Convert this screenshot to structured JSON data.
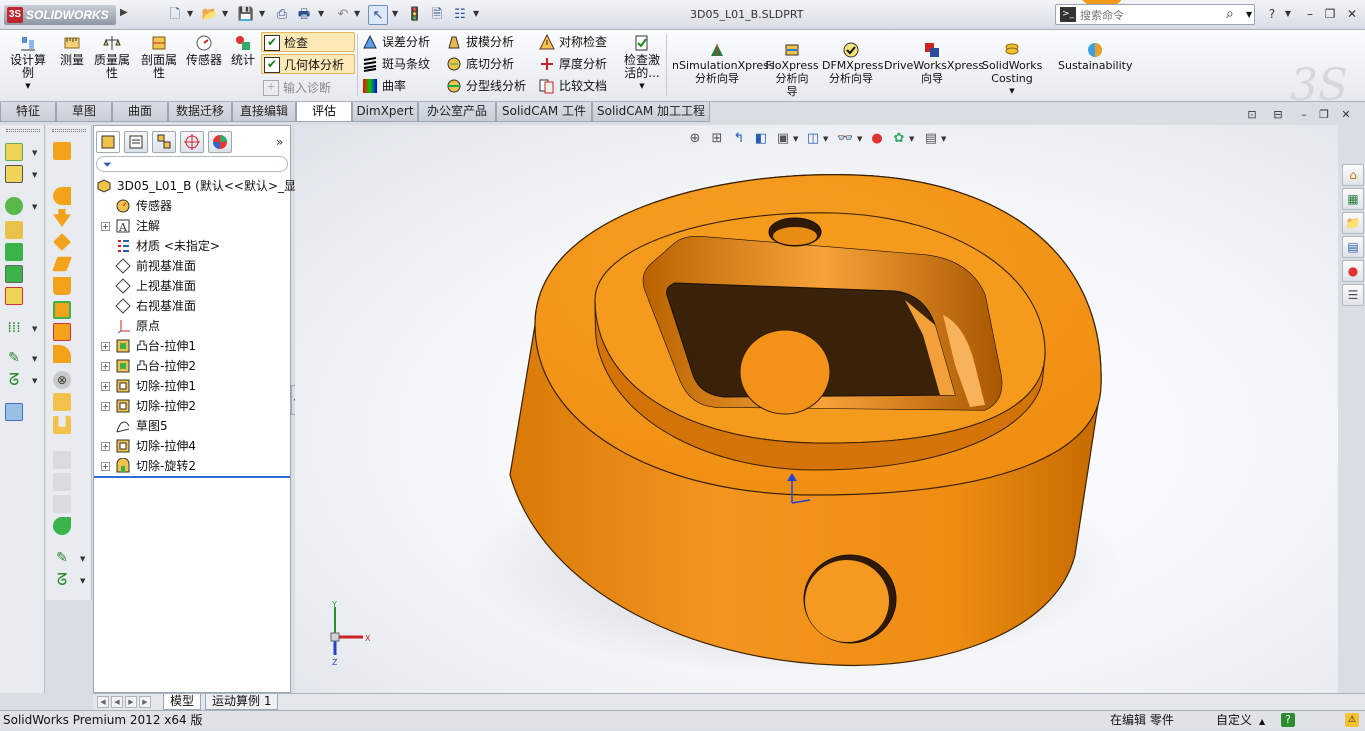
{
  "app": {
    "logo_text": "SOLIDWORKS",
    "document_title": "3D05_L01_B.SLDPRT",
    "search_placeholder": "搜索命令",
    "accent_color": "#f7931e"
  },
  "toolbar": {
    "big_buttons": [
      {
        "label": "设计算\n例",
        "icon": "design-study-icon"
      },
      {
        "label": "测量",
        "icon": "measure-icon"
      },
      {
        "label": "质量属\n性",
        "icon": "mass-properties-icon"
      },
      {
        "label": "剖面属\n性",
        "icon": "section-properties-icon"
      },
      {
        "label": "传感器",
        "icon": "sensor-icon"
      },
      {
        "label": "统计",
        "icon": "statistics-icon"
      }
    ],
    "col1": [
      {
        "label": "检查",
        "checked": true
      },
      {
        "label": "几何体分析",
        "checked": true
      },
      {
        "label": "输入诊断",
        "disabled": true
      }
    ],
    "col2": [
      {
        "label": "误差分析"
      },
      {
        "label": "斑马条纹"
      },
      {
        "label": "曲率"
      }
    ],
    "col3": [
      {
        "label": "拔模分析"
      },
      {
        "label": "底切分析"
      },
      {
        "label": "分型线分析"
      }
    ],
    "col4": [
      {
        "label": "对称检查"
      },
      {
        "label": "厚度分析"
      },
      {
        "label": "比较文档"
      }
    ],
    "check_active": "检查激\n活的...",
    "xpress": [
      {
        "label": "nSimulationXpress\n分析向导"
      },
      {
        "label": "FloXpress\n分析向\n导"
      },
      {
        "label": "DFMXpress\n分析向导"
      },
      {
        "label": "DriveWorksXpress\n向导"
      },
      {
        "label": "SolidWorks\nCosting"
      },
      {
        "label": "Sustainability"
      }
    ]
  },
  "tabs": [
    {
      "label": "特征"
    },
    {
      "label": "草图"
    },
    {
      "label": "曲面"
    },
    {
      "label": "数据迁移"
    },
    {
      "label": "直接编辑"
    },
    {
      "label": "评估",
      "active": true
    },
    {
      "label": "DimXpert"
    },
    {
      "label": "办公室产品"
    },
    {
      "label": "SolidCAM 工件"
    },
    {
      "label": "SolidCAM 加工工程"
    }
  ],
  "feature_tree": {
    "root": "3D05_L01_B  (默认<<默认>_显",
    "items": [
      {
        "label": "传感器",
        "icon": "sensor-icon",
        "expandable": false
      },
      {
        "label": "注解",
        "icon": "annotation-icon",
        "expandable": true
      },
      {
        "label": "材质 <未指定>",
        "icon": "material-icon",
        "expandable": false
      },
      {
        "label": "前视基准面",
        "icon": "plane-icon",
        "expandable": false
      },
      {
        "label": "上视基准面",
        "icon": "plane-icon",
        "expandable": false
      },
      {
        "label": "右视基准面",
        "icon": "plane-icon",
        "expandable": false
      },
      {
        "label": "原点",
        "icon": "origin-icon",
        "expandable": false
      },
      {
        "label": "凸台-拉伸1",
        "icon": "boss-extrude-icon",
        "expandable": true
      },
      {
        "label": "凸台-拉伸2",
        "icon": "boss-extrude-icon",
        "expandable": true
      },
      {
        "label": "切除-拉伸1",
        "icon": "cut-extrude-icon",
        "expandable": true
      },
      {
        "label": "切除-拉伸2",
        "icon": "cut-extrude-icon",
        "expandable": true
      },
      {
        "label": "草图5",
        "icon": "sketch-icon",
        "expandable": false
      },
      {
        "label": "切除-拉伸4",
        "icon": "cut-extrude-icon",
        "expandable": true
      },
      {
        "label": "切除-旋转2",
        "icon": "cut-revolve-icon",
        "expandable": true
      }
    ]
  },
  "model": {
    "part_color": "#f39018",
    "shadow_color": "#b85f00"
  },
  "triad": {
    "x": "X",
    "y": "Y",
    "z": "Z"
  },
  "bottom_tabs": [
    {
      "label": "模型",
      "active": true
    },
    {
      "label": "运动算例 1"
    }
  ],
  "status": {
    "app": "SolidWorks Premium 2012 x64 版",
    "mode": "在编辑 零件",
    "units": "自定义"
  }
}
